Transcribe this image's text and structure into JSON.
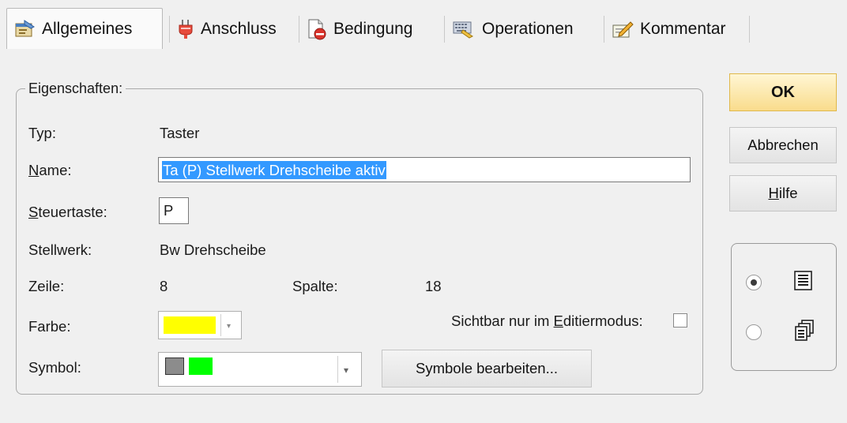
{
  "tabs": [
    {
      "label": "Allgemeines",
      "icon": "properties-icon"
    },
    {
      "label": "Anschluss",
      "icon": "plug-icon"
    },
    {
      "label": "Bedingung",
      "icon": "condition-icon"
    },
    {
      "label": "Operationen",
      "icon": "operations-icon"
    },
    {
      "label": "Kommentar",
      "icon": "comment-icon"
    }
  ],
  "group": {
    "title": "Eigenschaften:"
  },
  "fields": {
    "typ": {
      "label": "Typ:",
      "value": "Taster"
    },
    "name": {
      "label_mn": "N",
      "label_rest": "ame:",
      "value": "Ta (P) Stellwerk Drehscheibe aktiv"
    },
    "steuertaste": {
      "label_mn": "S",
      "label_rest": "teuertaste:",
      "value": "P"
    },
    "stellwerk": {
      "label": "Stellwerk:",
      "value": "Bw Drehscheibe"
    },
    "zeile": {
      "label": "Zeile:",
      "value": "8"
    },
    "spalte": {
      "label": "Spalte:",
      "value": "18"
    },
    "farbe": {
      "label": "Farbe:",
      "color": "#ffff00"
    },
    "sichtbar": {
      "label_pre": "Sichtbar nur im ",
      "label_mn": "E",
      "label_rest": "ditiermodus:",
      "checked": false
    },
    "symbol": {
      "label": "Symbol:",
      "colors": [
        "#8c8c8c",
        "#00ff00"
      ],
      "button": "Symbole bearbeiten..."
    }
  },
  "buttons": {
    "ok": "OK",
    "cancel": "Abbrechen",
    "help_mn": "H",
    "help_rest": "ilfe"
  },
  "view_mode": {
    "options": [
      "list-view-icon",
      "cascade-icon"
    ],
    "selected": 0
  }
}
